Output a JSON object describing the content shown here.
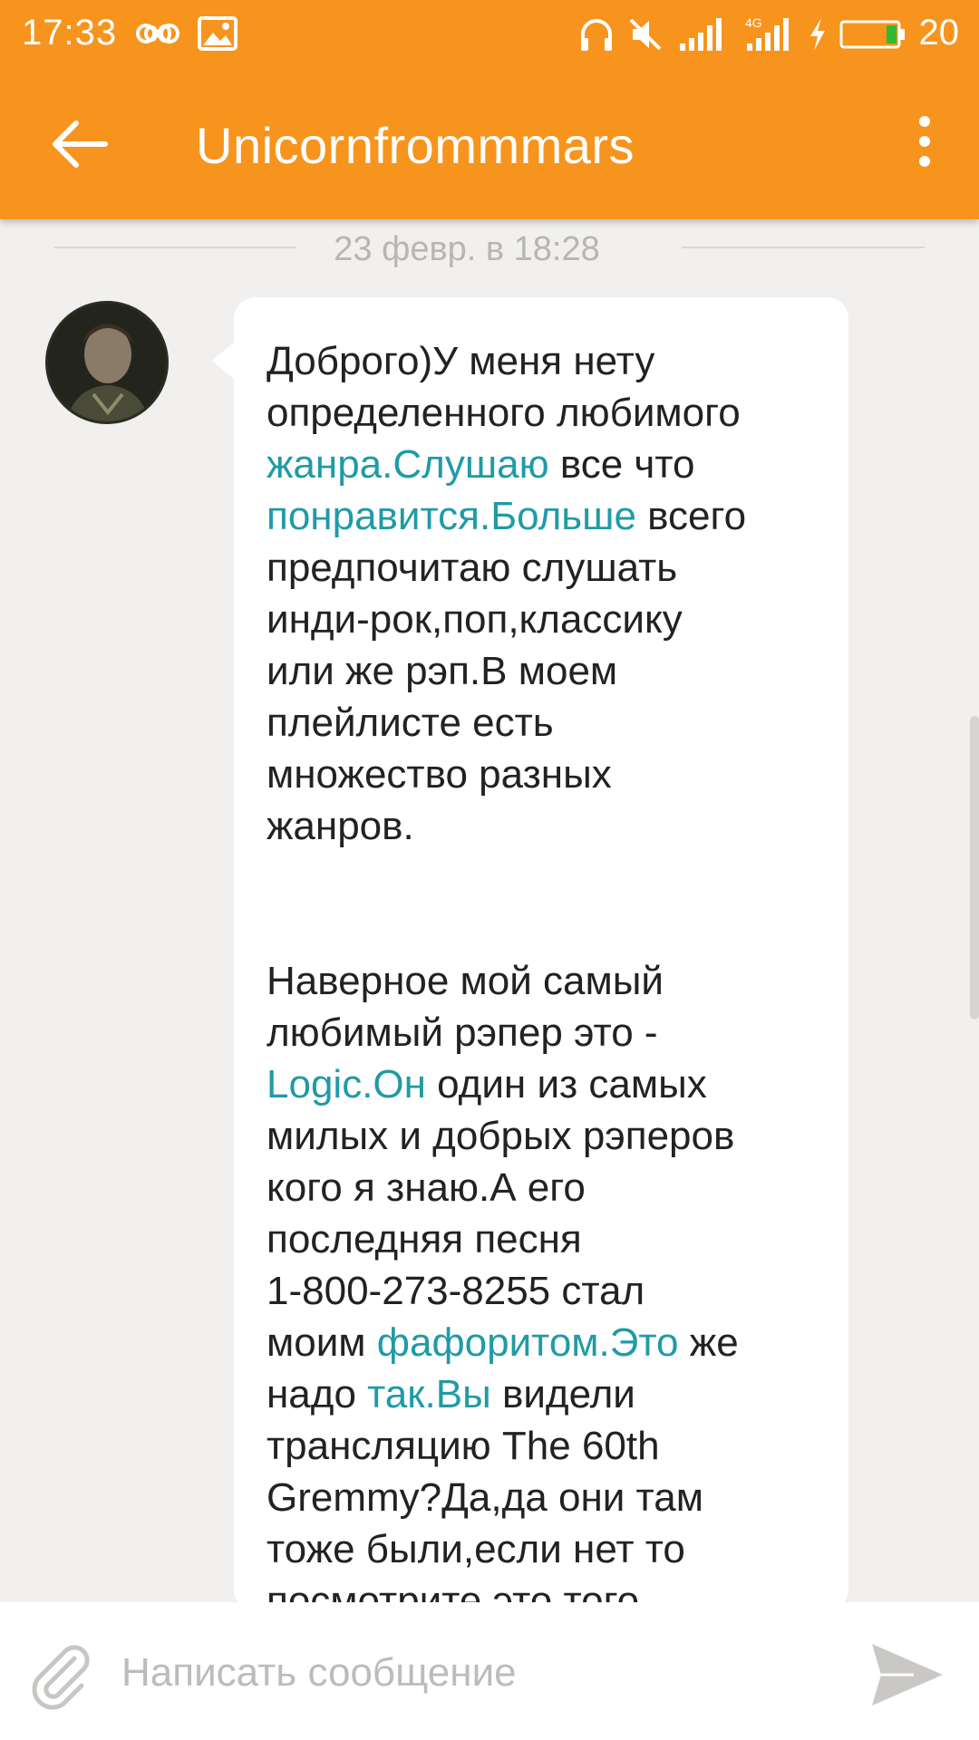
{
  "status_bar": {
    "time": "17:33",
    "battery": "20"
  },
  "toolbar": {
    "title": "Unicornfrommmars",
    "accent": "#f7941d"
  },
  "chat": {
    "date": "23 февр. в 18:28",
    "message": {
      "paragraph1": {
        "t1": "Доброго)У меня нету\nопределенного любимого\n",
        "l1": "жанра.Слушаю",
        "t2": " все что\n",
        "l2": "понравится.Больше",
        "t3": " всего\nпредпочитаю слушать\nинди-рок,поп,классику\nили же рэп.В моем\nплейлисте есть\nмножество разных\nжанров."
      },
      "paragraph2": {
        "t1": "Наверное мой самый\nлюбимый рэпер это -\n",
        "l1": "Logic.Он",
        "t2": " один из самых\nмилых и добрых рэперов\nкого я знаю.А его\nпоследняя песня\n1-800-273-8255 стал\nмоим ",
        "l2": "фафоритом.Это",
        "t3": " же\nнадо ",
        "l3": "так.Вы",
        "t4": " видели\nтрансляцию The 60th\nGremmy?Да,да они там\nтоже были,если нет то\nпосмотрите это того\nстоит."
      }
    }
  },
  "composer": {
    "placeholder": "Написать сообщение"
  },
  "colors": {
    "link": "#1f9ba6",
    "background": "#f1f0ee"
  }
}
